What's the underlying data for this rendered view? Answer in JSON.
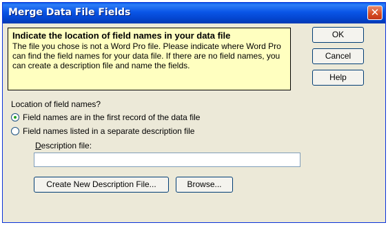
{
  "window": {
    "title": "Merge Data File Fields",
    "close_symbol": "✕"
  },
  "hint": {
    "title": "Indicate the location of field names in your data file",
    "body": "The file you chose is not a Word Pro file. Please indicate where Word Pro can find the field names for your data file. If there are no field names, you can create a description file and name the fields."
  },
  "buttons": {
    "ok": "OK",
    "cancel": "Cancel",
    "help": "Help"
  },
  "location": {
    "label": "Location of field names?",
    "options": [
      {
        "label": "Field names are in the first record of the data file",
        "selected": true
      },
      {
        "label": "Field names listed in a separate description file",
        "selected": false
      }
    ]
  },
  "description_file": {
    "label_accel": "D",
    "label_rest": "escription file:",
    "value": ""
  },
  "actions": {
    "create": "Create New Description File...",
    "browse": "Browse..."
  }
}
